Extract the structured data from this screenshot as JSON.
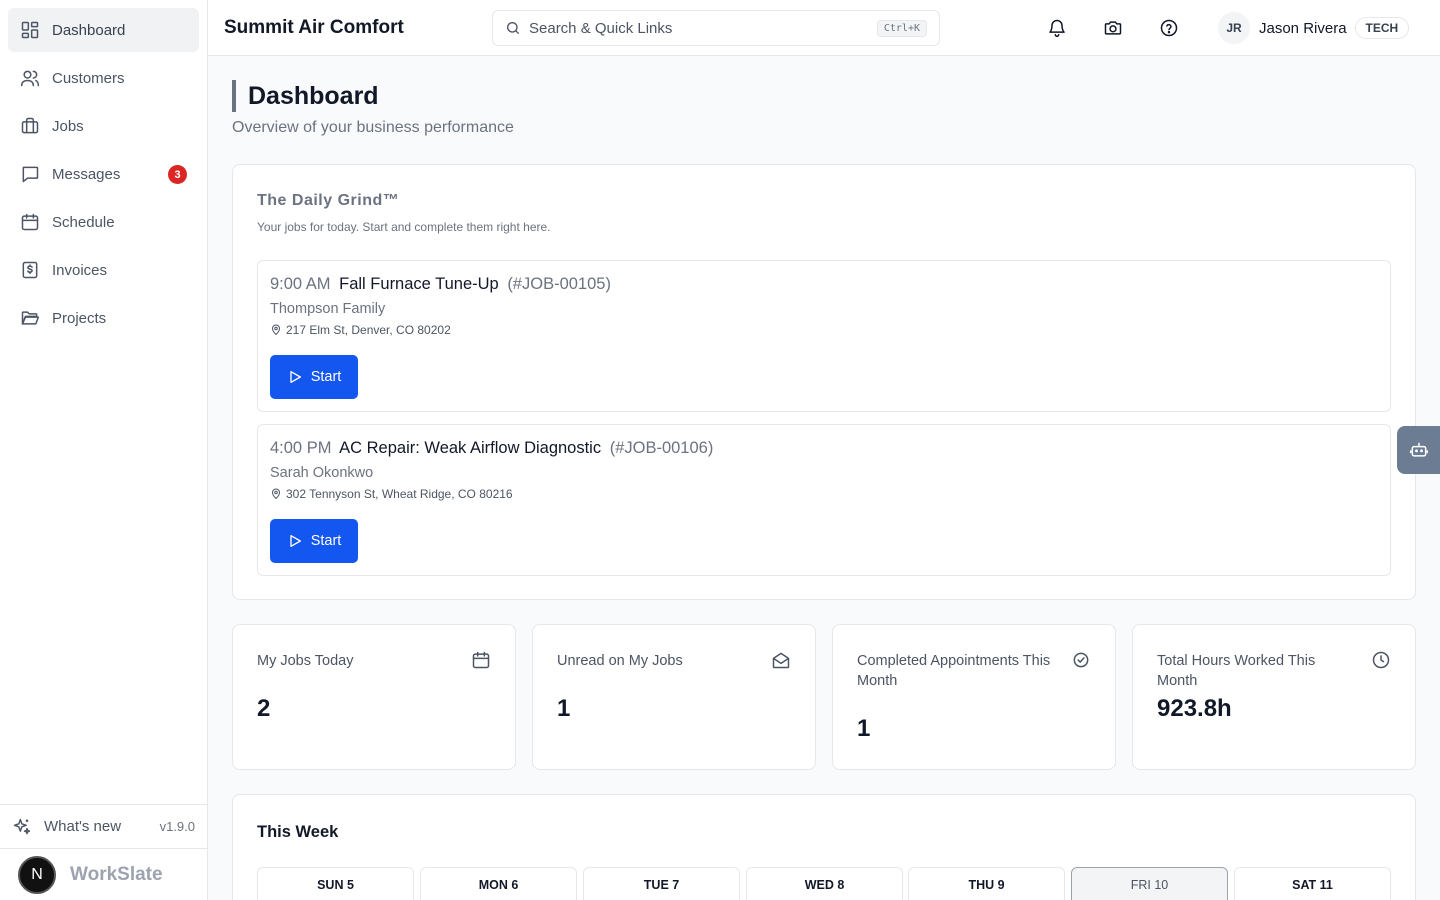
{
  "sidebar": {
    "items": [
      {
        "label": "Dashboard",
        "icon": "dashboard-icon"
      },
      {
        "label": "Customers",
        "icon": "users-icon"
      },
      {
        "label": "Jobs",
        "icon": "briefcase-icon"
      },
      {
        "label": "Messages",
        "icon": "message-icon",
        "badge": "3"
      },
      {
        "label": "Schedule",
        "icon": "calendar-icon"
      },
      {
        "label": "Invoices",
        "icon": "invoice-icon"
      },
      {
        "label": "Projects",
        "icon": "folder-icon"
      }
    ],
    "whats_new": "What's new",
    "version": "v1.9.0",
    "brand_initial": "N",
    "brand_name": "WorkSlate"
  },
  "header": {
    "company": "Summit Air Comfort",
    "search_placeholder": "Search & Quick Links",
    "search_shortcut": "Ctrl+K",
    "user_initials": "JR",
    "user_name": "Jason Rivera",
    "user_role": "TECH"
  },
  "page": {
    "title": "Dashboard",
    "subtitle": "Overview of your business performance"
  },
  "daily_grind": {
    "title": "The Daily Grind™",
    "subtitle": "Your jobs for today. Start and complete them right here.",
    "jobs": [
      {
        "time": "9:00 AM",
        "title": "Fall Furnace Tune-Up",
        "number": "(#JOB-00105)",
        "customer": "Thompson Family",
        "address": "217 Elm St, Denver, CO 80202",
        "button": "Start"
      },
      {
        "time": "4:00 PM",
        "title": "AC Repair: Weak Airflow Diagnostic",
        "number": "(#JOB-00106)",
        "customer": "Sarah Okonkwo",
        "address": "302 Tennyson St, Wheat Ridge, CO 80216",
        "button": "Start"
      }
    ]
  },
  "stats": [
    {
      "label": "My Jobs Today",
      "value": "2",
      "icon": "calendar-icon"
    },
    {
      "label": "Unread on My Jobs",
      "value": "1",
      "icon": "mail-open-icon"
    },
    {
      "label": "Completed Appointments This Month",
      "value": "1",
      "icon": "check-circle-icon"
    },
    {
      "label": "Total Hours Worked This Month",
      "value": "923.8h",
      "icon": "clock-icon"
    }
  ],
  "week": {
    "title": "This Week",
    "days": [
      "SUN 5",
      "MON 6",
      "TUE 7",
      "WED 8",
      "THU 9",
      "FRI 10",
      "SAT 11"
    ],
    "today": "FRI 10"
  },
  "colors": {
    "accent": "#1456f0",
    "badge": "#dc2626",
    "assistant_tab": "#6b7c93"
  }
}
